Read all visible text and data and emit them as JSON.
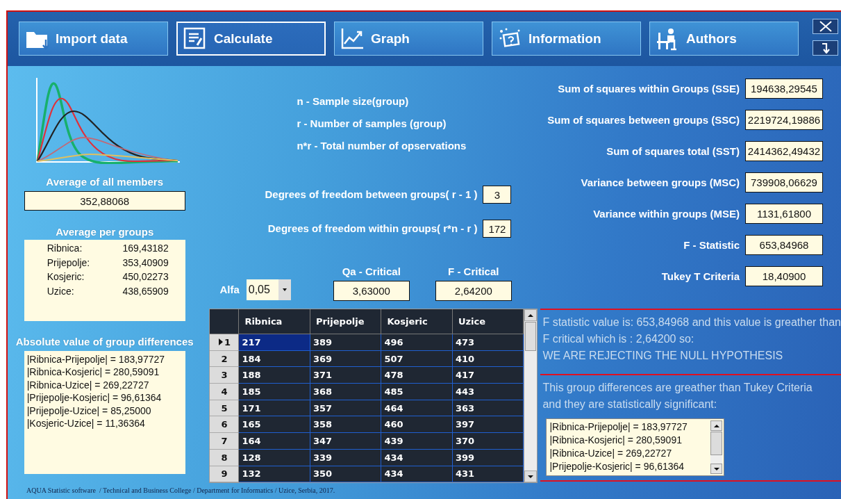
{
  "toolbar": {
    "buttons": [
      {
        "label": "Import data",
        "selected": false
      },
      {
        "label": "Calculate",
        "selected": true
      },
      {
        "label": "Graph",
        "selected": false
      },
      {
        "label": "Information",
        "selected": false
      },
      {
        "label": "Authors",
        "selected": false
      }
    ]
  },
  "overall_average": {
    "title": "Average of all members",
    "value": "352,88068"
  },
  "group_averages": {
    "title": "Average per groups",
    "items": [
      {
        "name": "Ribnica:",
        "value": "169,43182"
      },
      {
        "name": "Prijepolje:",
        "value": "353,40909"
      },
      {
        "name": "Kosjeric:",
        "value": "450,02273"
      },
      {
        "name": "Uzice:",
        "value": "438,65909"
      }
    ]
  },
  "group_differences": {
    "title": "Absolute value of group differences",
    "items": [
      "|Ribnica-Prijepolje| = 183,97727",
      "|Ribnica-Kosjeric| = 280,59091",
      "|Ribnica-Uzice| = 269,22727",
      "|Prijepolje-Kosjeric| = 96,61364",
      "|Prijepolje-Uzice| = 85,25000",
      "|Kosjeric-Uzice| = 11,36364"
    ]
  },
  "definitions": [
    "n - Sample size(group)",
    "r - Number of samples (group)",
    "n*r - Total number of opservations"
  ],
  "degrees_of_freedom": [
    {
      "label": "Degrees of freedom between groups( r - 1 )",
      "value": "3"
    },
    {
      "label": "Degrees of freedom within groups( r*n - r )",
      "value": "172"
    }
  ],
  "alfa": {
    "label": "Alfa",
    "value": "0,05"
  },
  "critical_values": [
    {
      "label": "Qa - Critical",
      "value": "3,63000"
    },
    {
      "label": "F - Critical",
      "value": "2,64200"
    }
  ],
  "table": {
    "columns": [
      "Ribnica",
      "Prijepolje",
      "Kosjeric",
      "Uzice"
    ],
    "rows": [
      {
        "header": "1",
        "cells": [
          "217",
          "389",
          "496",
          "473"
        ],
        "selected": true
      },
      {
        "header": "2",
        "cells": [
          "184",
          "369",
          "507",
          "410"
        ],
        "selected": false
      },
      {
        "header": "3",
        "cells": [
          "188",
          "371",
          "478",
          "417"
        ],
        "selected": false
      },
      {
        "header": "4",
        "cells": [
          "185",
          "368",
          "485",
          "443"
        ],
        "selected": false
      },
      {
        "header": "5",
        "cells": [
          "171",
          "357",
          "464",
          "363"
        ],
        "selected": false
      },
      {
        "header": "6",
        "cells": [
          "165",
          "358",
          "460",
          "397"
        ],
        "selected": false
      },
      {
        "header": "7",
        "cells": [
          "164",
          "347",
          "439",
          "370"
        ],
        "selected": false
      },
      {
        "header": "8",
        "cells": [
          "128",
          "339",
          "434",
          "399"
        ],
        "selected": false
      },
      {
        "header": "9",
        "cells": [
          "132",
          "350",
          "434",
          "431"
        ],
        "selected": false
      }
    ]
  },
  "statistics": [
    {
      "label": "Sum of squares within Groups (SSE)",
      "value": "194638,29545"
    },
    {
      "label": "Sum of squares between groups (SSC)",
      "value": "2219724,19886"
    },
    {
      "label": "Sum of squares total (SST)",
      "value": "2414362,49432"
    },
    {
      "label": "Variance between groups (MSC)",
      "value": "739908,06629"
    },
    {
      "label": "Variance within groups (MSE)",
      "value": "1131,61800"
    },
    {
      "label": "F - Statistic",
      "value": "653,84968"
    },
    {
      "label": "Tukey T Criteria",
      "value": "18,40900"
    }
  ],
  "conclusion": [
    "F statistic value is: 653,84968 and this value is greather than",
    "F critical which is : 2,64200 so:",
    "WE ARE REJECTING THE NULL HYPOTHESIS"
  ],
  "tukey_note": [
    "This group differences are greather than Tukey Criteria",
    "and they are statistically significant:"
  ],
  "significant_differences": [
    "|Ribnica-Prijepolje| = 183,97727",
    "|Ribnica-Kosjeric| = 280,59091",
    "|Ribnica-Uzice| = 269,22727",
    "|Prijepolje-Kosjeric| = 96,61364"
  ],
  "footer": "AQUA Statistic software  / Technical and Business College / Department for Informatics / Uzice, Serbia, 2017."
}
